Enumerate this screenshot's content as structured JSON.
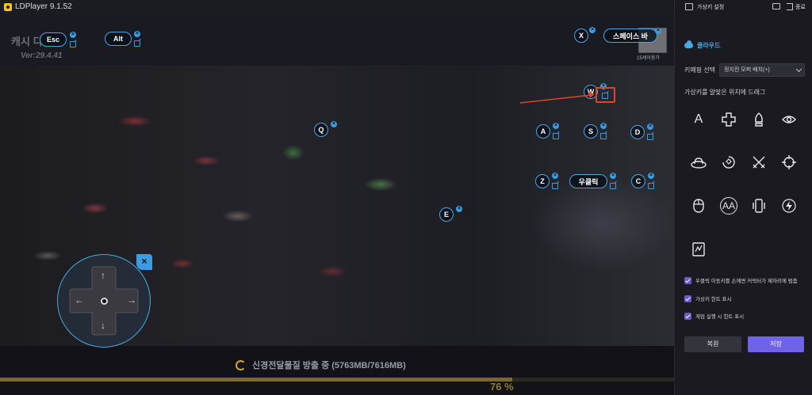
{
  "titlebar": {
    "title": "LDPlayer 9.1.52"
  },
  "game": {
    "watermark": "캐시 디",
    "version": "Ver:29.4.41",
    "thumb_caption": "15세이용가",
    "loading_text": "신경전달물질 방출 중 (5763MB/7616MB)",
    "progress_percent": 76,
    "progress_label": "76 %"
  },
  "keys": {
    "esc": "Esc",
    "alt": "Alt",
    "x": "X",
    "space": "스페이스 바",
    "w": "W",
    "q": "Q",
    "a": "A",
    "s": "S",
    "d": "D",
    "z": "Z",
    "right_click": "우클릭",
    "c": "C",
    "e": "E"
  },
  "panel": {
    "title": "가상키 설정",
    "exit_label": "종료",
    "cloud_label": "클라우드",
    "mapping_label": "키매핑 선택",
    "mapping_selected": "정지전 모퍼 배치(+)",
    "drag_hint": "가상키를 알맞은 위치에 드래그",
    "tools": {
      "text_key": "A",
      "aa_key": "AA"
    },
    "options": [
      {
        "label": "우클릭 이동키를 손에면 커릭터가 제자리에 멈춤",
        "checked": true
      },
      {
        "label": "가상키 힌트 표시",
        "checked": true
      },
      {
        "label": "게임 실행 시 힌트 표시",
        "checked": true
      }
    ],
    "reset_label": "복원",
    "save_label": "저장"
  },
  "colors": {
    "accent_blue": "#4aa8e0",
    "highlight_red": "#e0452b",
    "save_purple": "#6f63ea",
    "progress_gold": "#8f7c35"
  }
}
